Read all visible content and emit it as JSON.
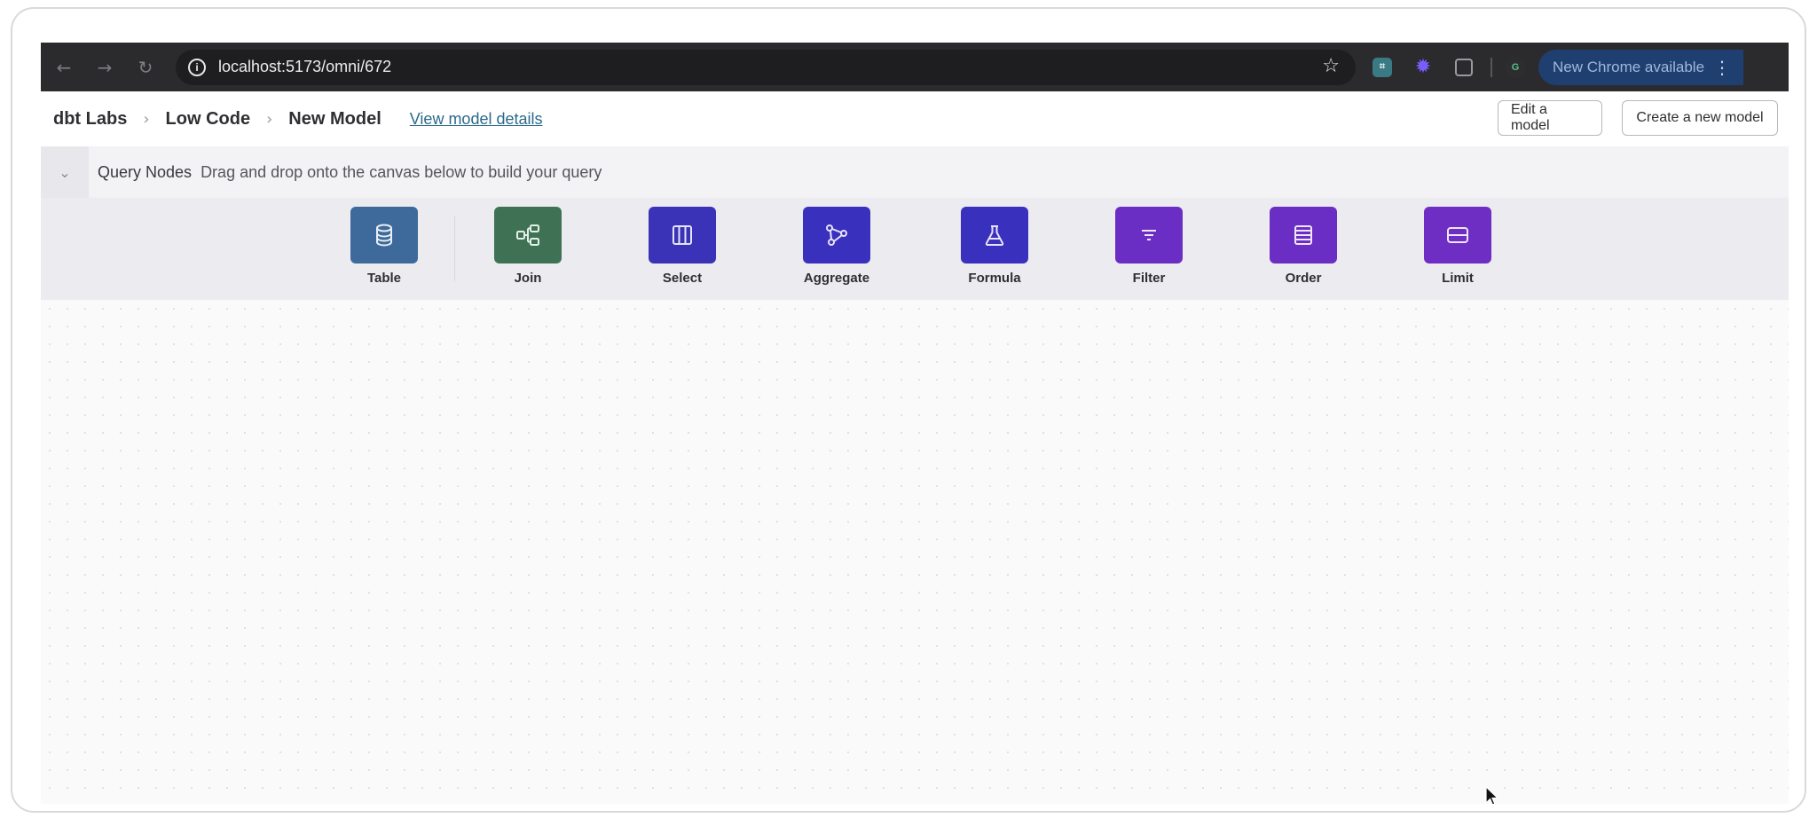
{
  "browser": {
    "url": "localhost:5173/omni/672",
    "ext1_label": "⌗",
    "profile_initial": "G",
    "update_label": "New Chrome available"
  },
  "breadcrumb": {
    "items": [
      "dbt Labs",
      "Low Code",
      "New Model"
    ],
    "separator": "›",
    "view_details": "View model details"
  },
  "header_actions": {
    "edit_model": "Edit a model",
    "create_model": "Create a new model"
  },
  "query_nodes": {
    "title": "Query Nodes",
    "subtitle": "Drag and drop onto the canvas below to build your query",
    "nodes": [
      {
        "label": "Table",
        "icon": "database-icon",
        "color": "#3d6a9a"
      },
      {
        "label": "Join",
        "icon": "join-icon",
        "color": "#3f7254"
      },
      {
        "label": "Select",
        "icon": "columns-icon",
        "color": "#3a33b8"
      },
      {
        "label": "Aggregate",
        "icon": "branch-icon",
        "color": "#3a30be"
      },
      {
        "label": "Formula",
        "icon": "flask-icon",
        "color": "#3a30be"
      },
      {
        "label": "Filter",
        "icon": "filter-icon",
        "color": "#6b2ec4"
      },
      {
        "label": "Order",
        "icon": "list-icon",
        "color": "#6b2ec4"
      },
      {
        "label": "Limit",
        "icon": "limit-icon",
        "color": "#6e2ec4"
      }
    ]
  }
}
